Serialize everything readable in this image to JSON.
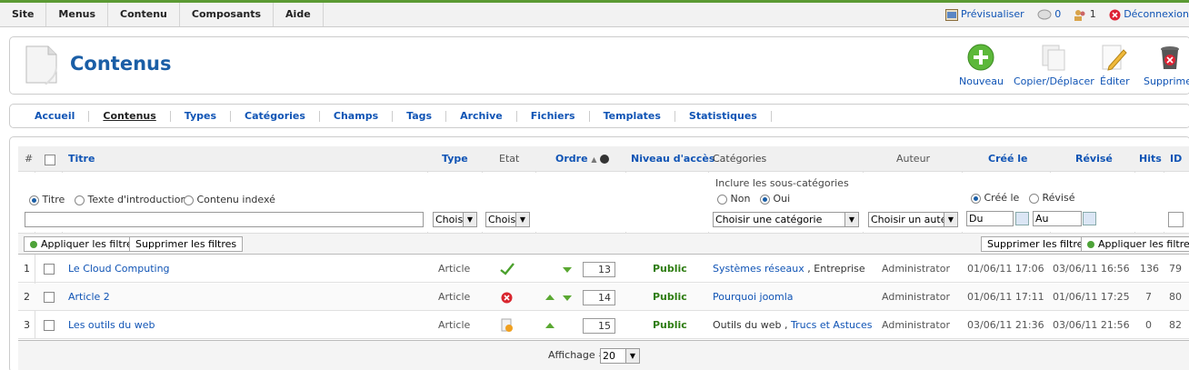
{
  "menu": {
    "items": [
      "Site",
      "Menus",
      "Contenu",
      "Composants",
      "Aide"
    ]
  },
  "status": {
    "preview": "Prévisualiser",
    "messages": "0",
    "users": "1",
    "logout": "Déconnexion"
  },
  "header": {
    "title": "Contenus"
  },
  "toolbar": {
    "new": "Nouveau",
    "copy": "Copier/Déplacer",
    "edit": "Éditer",
    "delete": "Supprimer"
  },
  "tabs": [
    "Accueil",
    "Contenus",
    "Types",
    "Catégories",
    "Champs",
    "Tags",
    "Archive",
    "Fichiers",
    "Templates",
    "Statistiques"
  ],
  "columns": {
    "num": "#",
    "title": "Titre",
    "type": "Type",
    "state": "Etat",
    "order": "Ordre",
    "access": "Niveau d'accès",
    "categories": "Catégories",
    "author": "Auteur",
    "created": "Créé le",
    "revised": "Révisé",
    "hits": "Hits",
    "id": "ID"
  },
  "filters": {
    "search_modes": [
      "Titre",
      "Texte d'introduction",
      "Contenu indexé"
    ],
    "type_select": "Choisi",
    "state_select": "Choisi",
    "include_sub": "Inclure les sous-catégories",
    "no": "Non",
    "yes": "Oui",
    "category_select": "Choisir une catégorie",
    "author_select": "Choisir un auteur",
    "date_created": "Créé le",
    "date_revised": "Révisé",
    "from": "Du",
    "to": "Au",
    "apply": "Appliquer les filtres",
    "clear": "Supprimer les filtres"
  },
  "rows": [
    {
      "num": "1",
      "title": "Le Cloud Computing",
      "type": "Article",
      "state": "published",
      "order": "13",
      "access": "Public",
      "category": "Systèmes réseaux",
      "category2": "Entreprise",
      "author": "Administrator",
      "created": "01/06/11 17:06",
      "revised": "03/06/11 16:56",
      "hits": "136",
      "id": "79"
    },
    {
      "num": "2",
      "title": "Article 2",
      "type": "Article",
      "state": "unpublished",
      "order": "14",
      "access": "Public",
      "category": "Pourquoi joomla",
      "category2": "",
      "author": "Administrator",
      "created": "01/06/11 17:11",
      "revised": "01/06/11 17:25",
      "hits": "7",
      "id": "80"
    },
    {
      "num": "3",
      "title": "Les outils du web",
      "type": "Article",
      "state": "pending",
      "order": "15",
      "access": "Public",
      "category": "Outils du web",
      "category2": "Trucs et Astuces",
      "author": "Administrator",
      "created": "03/06/11 21:36",
      "revised": "03/06/11 21:56",
      "hits": "0",
      "id": "82"
    }
  ],
  "footer": {
    "display_label": "Affichage #",
    "display_value": "20"
  }
}
